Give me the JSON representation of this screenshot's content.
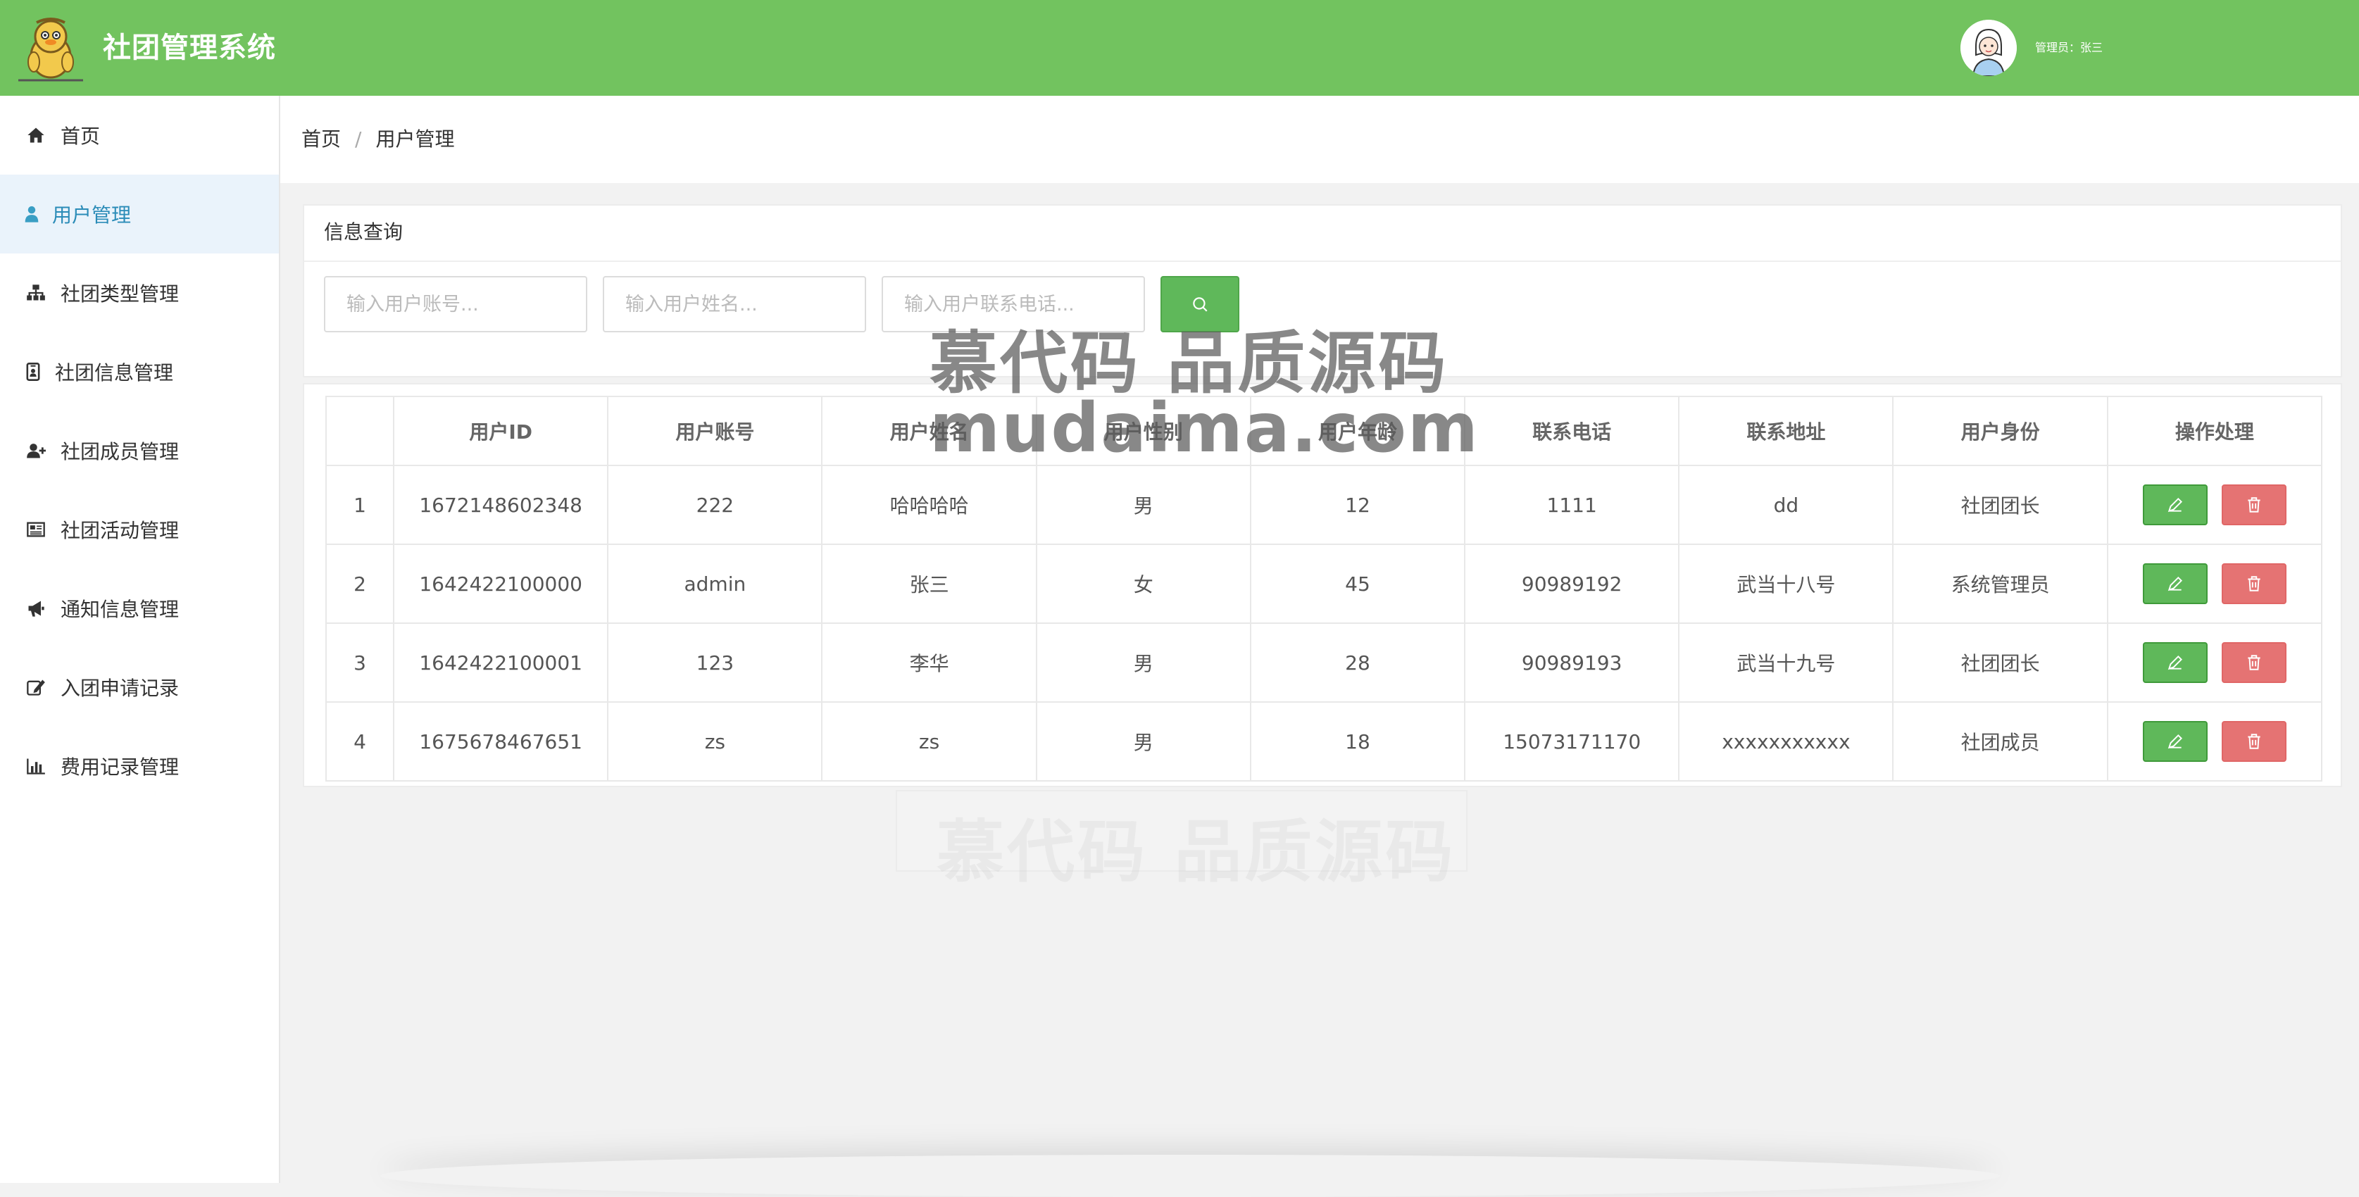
{
  "header": {
    "title": "社团管理系统",
    "admin_label": "管理员：张三"
  },
  "sidebar": {
    "items": [
      {
        "label": "首页",
        "icon": "home-icon"
      },
      {
        "label": "用户管理",
        "icon": "user-icon",
        "active": true
      },
      {
        "label": "社团类型管理",
        "icon": "sitemap-icon"
      },
      {
        "label": "社团信息管理",
        "icon": "id-badge-icon"
      },
      {
        "label": "社团成员管理",
        "icon": "user-plus-icon"
      },
      {
        "label": "社团活动管理",
        "icon": "newspaper-icon"
      },
      {
        "label": "通知信息管理",
        "icon": "bullhorn-icon"
      },
      {
        "label": "入团申请记录",
        "icon": "edit-icon"
      },
      {
        "label": "费用记录管理",
        "icon": "bar-chart-icon"
      }
    ]
  },
  "breadcrumb": {
    "home": "首页",
    "separator": "/",
    "current": "用户管理"
  },
  "search": {
    "title": "信息查询",
    "account_placeholder": "输入用户账号...",
    "name_placeholder": "输入用户姓名...",
    "phone_placeholder": "输入用户联系电话..."
  },
  "table": {
    "headers": [
      "",
      "用户ID",
      "用户账号",
      "用户姓名",
      "用户性别",
      "用户年龄",
      "联系电话",
      "联系地址",
      "用户身份",
      "操作处理"
    ],
    "rows": [
      [
        "1",
        "1672148602348",
        "222",
        "哈哈哈哈",
        "男",
        "12",
        "1111",
        "dd",
        "社团团长"
      ],
      [
        "2",
        "1642422100000",
        "admin",
        "张三",
        "女",
        "45",
        "90989192",
        "武当十八号",
        "系统管理员"
      ],
      [
        "3",
        "1642422100001",
        "123",
        "李华",
        "男",
        "28",
        "90989193",
        "武当十九号",
        "社团团长"
      ],
      [
        "4",
        "1675678467651",
        "zs",
        "zs",
        "男",
        "18",
        "15073171170",
        "xxxxxxxxxxx",
        "社团成员"
      ]
    ]
  },
  "watermark": {
    "line1": "慕代码 品质源码",
    "line2": "mudaima.com",
    "line3": "慕代码 品质源码"
  },
  "colors": {
    "header_bg": "#72c35f",
    "active_nav_bg": "#eaf3fb",
    "active_nav_text": "#2b8cb8",
    "edit_button": "#5fb85a",
    "delete_button": "#e57373"
  }
}
